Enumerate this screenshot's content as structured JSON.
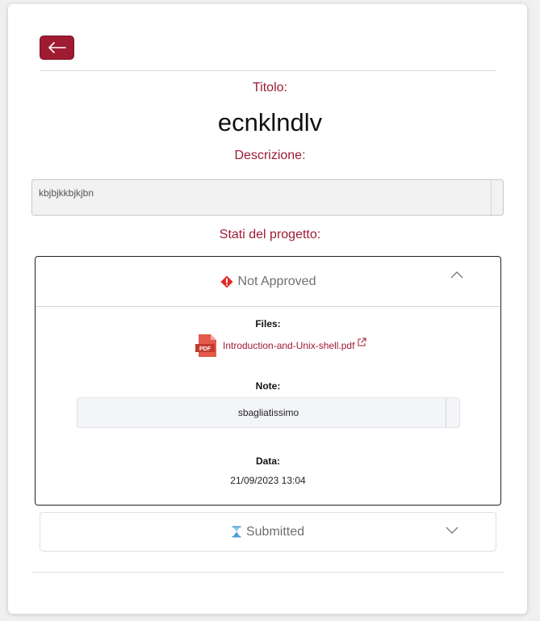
{
  "header": {
    "back_button": {
      "icon": "arrow-left-icon"
    }
  },
  "title": {
    "label": "Titolo:",
    "value": "ecnklndlv"
  },
  "description": {
    "label": "Descrizione:",
    "value": "kbjbjkkbjkjbn"
  },
  "project_states": {
    "label": "Stati del progetto:",
    "items": [
      {
        "status": "Not Approved",
        "status_icon": "error-diamond-icon",
        "status_color": "#e02a22",
        "expanded": true,
        "files_label": "Files:",
        "file_icon": "pdf-file-icon",
        "file_name": "Introduction-and-Unix-shell.pdf",
        "note_label": "Note:",
        "note_value": "sbagliatissimo",
        "date_label": "Data:",
        "date_value": "21/09/2023 13:04"
      },
      {
        "status": "Submitted",
        "status_icon": "hourglass-icon",
        "status_color": "#4a9fd8",
        "expanded": false
      }
    ]
  },
  "colors": {
    "accent": "#9e1b32",
    "status_text": "#707070"
  }
}
